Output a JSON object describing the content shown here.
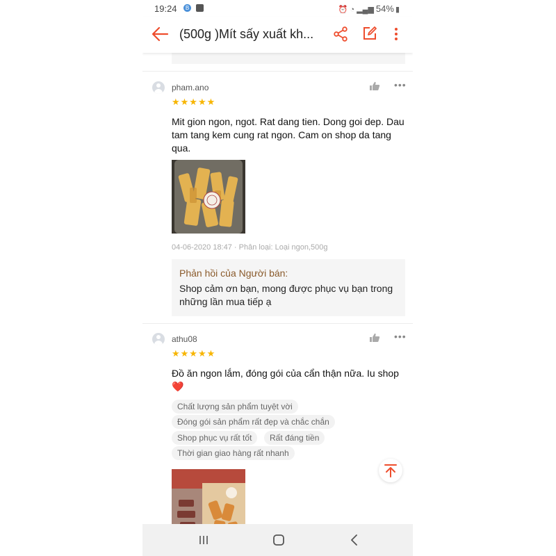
{
  "status_bar": {
    "time": "19:24",
    "battery": "54%"
  },
  "app_bar": {
    "title": "(500g )Mít sấy xuất kh..."
  },
  "reviews": [
    {
      "username": "pham.ano",
      "stars": "★★★★★",
      "comment": "Mit gion ngon, ngot. Rat dang tien. Dong goi dep. Dau tam tang kem cung rat ngon. Cam on shop da tang qua.",
      "meta": "04-06-2020 18:47 · Phân loại: Loại ngon,500g",
      "seller_reply_header": "Phản hồi của Người bán:",
      "seller_reply_text": "Shop cảm ơn bạn, mong được phục vụ bạn trong những lần mua tiếp ạ"
    },
    {
      "username": "athu08",
      "stars": "★★★★★",
      "comment": "Đồ ăn ngon lắm, đóng gói của cẩn thận nữa. Iu shop",
      "comment_heart": "❤️",
      "tags": [
        "Chất lượng sản phẩm tuyệt vời",
        "Đóng gói sản phẩm rất đẹp và chắc chắn",
        "Shop phục vụ rất tốt",
        "Rất đáng tiền",
        "Thời gian giao hàng rất nhanh"
      ]
    }
  ],
  "colors": {
    "accent": "#ee4d2d",
    "star": "#f7b500",
    "seller_header": "#8a5a2b"
  }
}
